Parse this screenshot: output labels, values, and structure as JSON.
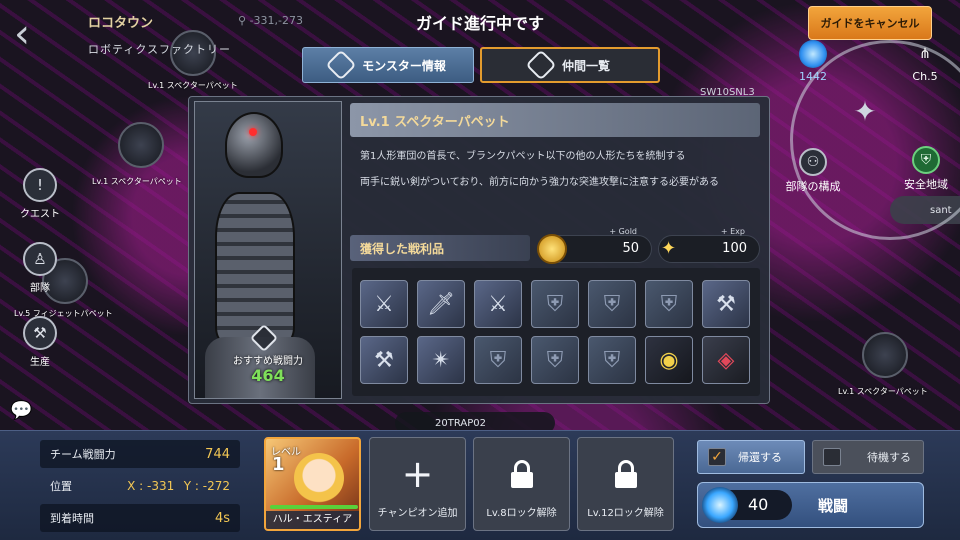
{
  "header": {
    "back_icon": "chevron-left-icon",
    "location_name": "ロコタウン",
    "location_coord": "-331,-273",
    "location_sub": "ロボティクスファクトリー",
    "guide_status": "ガイド進行中です",
    "cancel_guide_label": "ガイドをキャンセル"
  },
  "map": {
    "labels": [
      "Lv.1 スペクターパペット",
      "Lv.1 スペクターパペット",
      "Lv.5 フィジェットパペット",
      "Lv.1 スペクターパペット"
    ],
    "side_menu": [
      {
        "label": "クエスト",
        "icon": "quest-icon"
      },
      {
        "label": "部隊",
        "icon": "party-icon"
      },
      {
        "label": "生産",
        "icon": "production-icon"
      }
    ],
    "right_items": [
      {
        "label": "1442",
        "icon": "orb-icon"
      },
      {
        "label": "Ch.5",
        "icon": "channel-icon"
      },
      {
        "label": "部隊の構成",
        "icon": "formation-icon"
      },
      {
        "label": "安全地域",
        "icon": "shield-icon"
      }
    ],
    "zone_tag": "20TRAP02",
    "sant_tag": "sant",
    "sw_tag": "SW10SNL3"
  },
  "tabs": {
    "monster_info": "モンスター情報",
    "friends_list": "仲間一覧"
  },
  "monster": {
    "title": "Lv.1 スペクターパペット",
    "desc1": "第1人形軍団の首長で、ブランクパペット以下の他の人形たちを統制する",
    "desc2": "両手に鋭い剣がついており、前方に向かう強力な突進攻撃に注意する必要がある",
    "recommended_power_label": "おすすめ戦闘力",
    "recommended_power": "464"
  },
  "loot": {
    "heading": "獲得した戦利品",
    "gold_tag": "+ Gold",
    "gold_value": "50",
    "exp_tag": "+ Exp",
    "exp_value": "100",
    "items": [
      {
        "icon": "blade-weapon-icon",
        "kind": "weapon"
      },
      {
        "icon": "sword-weapon-icon",
        "kind": "weapon"
      },
      {
        "icon": "greatsword-weapon-icon",
        "kind": "weapon"
      },
      {
        "icon": "armor-material-icon",
        "kind": "material"
      },
      {
        "icon": "armor-material-icon",
        "kind": "material"
      },
      {
        "icon": "armor-material-icon",
        "kind": "material"
      },
      {
        "icon": "axe-weapon-icon",
        "kind": "weapon"
      },
      {
        "icon": "axe-weapon-icon",
        "kind": "weapon"
      },
      {
        "icon": "spiked-blade-icon",
        "kind": "weapon"
      },
      {
        "icon": "armor-material-icon",
        "kind": "material"
      },
      {
        "icon": "armor-material-icon",
        "kind": "material"
      },
      {
        "icon": "armor-material-icon",
        "kind": "material"
      },
      {
        "icon": "robot-core-icon",
        "kind": "material"
      },
      {
        "icon": "robot-core-red-icon",
        "kind": "material"
      }
    ]
  },
  "team": {
    "power_label": "チーム戦闘力",
    "power_value": "744",
    "position_label": "位置",
    "pos_x": "X : -331",
    "pos_y": "Y : -272",
    "arrival_label": "到着時間",
    "arrival_value": "4s"
  },
  "champion": {
    "level_label": "レベル",
    "level": "1",
    "name": "ハル・エスティア",
    "hp_fraction": 1.0
  },
  "slots": {
    "add_champion": "チャンピオン追加",
    "lock8": "Lv.8ロック解除",
    "lock12": "Lv.12ロック解除"
  },
  "actions": {
    "return_label": "帰還する",
    "return_checked": true,
    "wait_label": "待機する",
    "wait_checked": false,
    "battle_cost": "40",
    "battle_label": "戦闘"
  },
  "colors": {
    "accent_orange": "#f2a53c",
    "power_green": "#7fe05a",
    "gold_text": "#f3c754"
  }
}
